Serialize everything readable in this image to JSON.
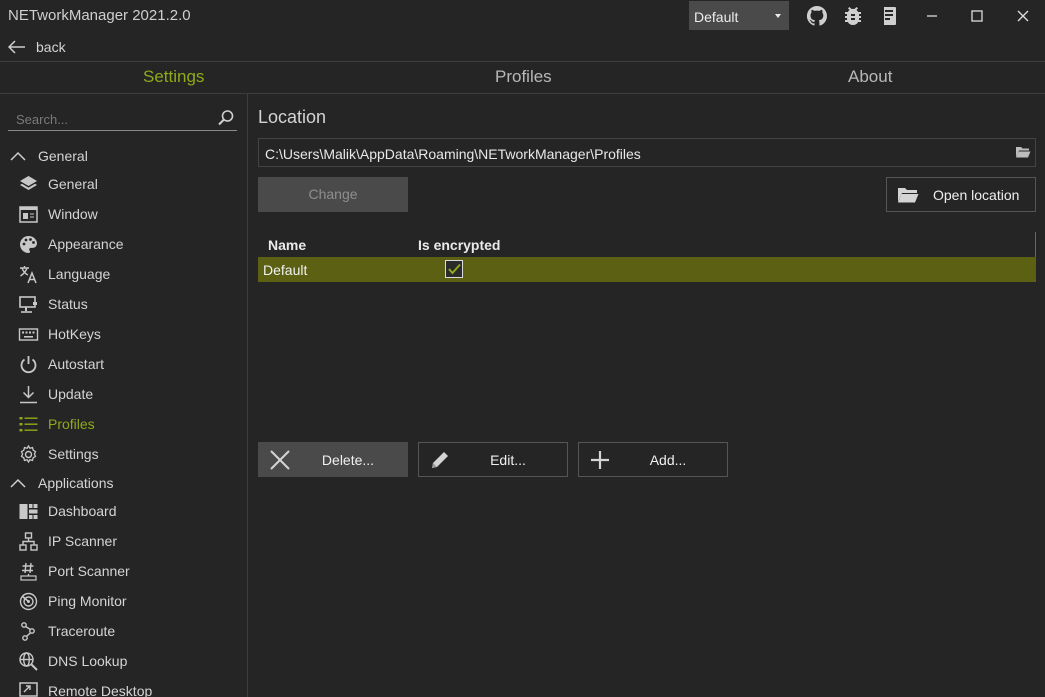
{
  "titlebar": {
    "title": "NETworkManager 2021.2.0",
    "theme_selected": "Default",
    "icons": [
      "github-icon",
      "bug-icon",
      "book-icon"
    ],
    "window_buttons": [
      "minimize-icon",
      "maximize-icon",
      "close-icon"
    ]
  },
  "back": {
    "label": "back"
  },
  "tabs": [
    {
      "label": "Settings",
      "active": true
    },
    {
      "label": "Profiles",
      "active": false
    },
    {
      "label": "About",
      "active": false
    }
  ],
  "sidebar": {
    "search_placeholder": "Search...",
    "groups": [
      {
        "label": "General",
        "items": [
          {
            "label": "General",
            "icon": "layers-icon"
          },
          {
            "label": "Window",
            "icon": "window-icon"
          },
          {
            "label": "Appearance",
            "icon": "palette-icon"
          },
          {
            "label": "Language",
            "icon": "translate-icon"
          },
          {
            "label": "Status",
            "icon": "monitor-network-icon"
          },
          {
            "label": "HotKeys",
            "icon": "keyboard-icon"
          },
          {
            "label": "Autostart",
            "icon": "power-icon"
          },
          {
            "label": "Update",
            "icon": "download-icon"
          },
          {
            "label": "Profiles",
            "icon": "list-icon",
            "active": true
          },
          {
            "label": "Settings",
            "icon": "gear-icon"
          }
        ]
      },
      {
        "label": "Applications",
        "items": [
          {
            "label": "Dashboard",
            "icon": "dashboard-icon"
          },
          {
            "label": "IP Scanner",
            "icon": "lan-icon"
          },
          {
            "label": "Port Scanner",
            "icon": "ethernet-port-icon"
          },
          {
            "label": "Ping Monitor",
            "icon": "radar-icon"
          },
          {
            "label": "Traceroute",
            "icon": "routes-icon"
          },
          {
            "label": "DNS Lookup",
            "icon": "magnify-globe-icon"
          },
          {
            "label": "Remote Desktop",
            "icon": "remote-desktop-icon"
          }
        ]
      }
    ]
  },
  "main": {
    "section_title": "Location",
    "path": "C:\\Users\\Malik\\AppData\\Roaming\\NETworkManager\\Profiles",
    "change_label": "Change",
    "open_location_label": "Open location",
    "table": {
      "columns": [
        "Name",
        "Is encrypted"
      ],
      "rows": [
        {
          "name": "Default",
          "is_encrypted": true
        }
      ]
    },
    "delete_label": "Delete...",
    "edit_label": "Edit...",
    "add_label": "Add..."
  },
  "colors": {
    "accent": "#8faa1a",
    "background": "#252525",
    "selected_row": "#5b6012",
    "disabled_button": "#4a4a4a"
  }
}
